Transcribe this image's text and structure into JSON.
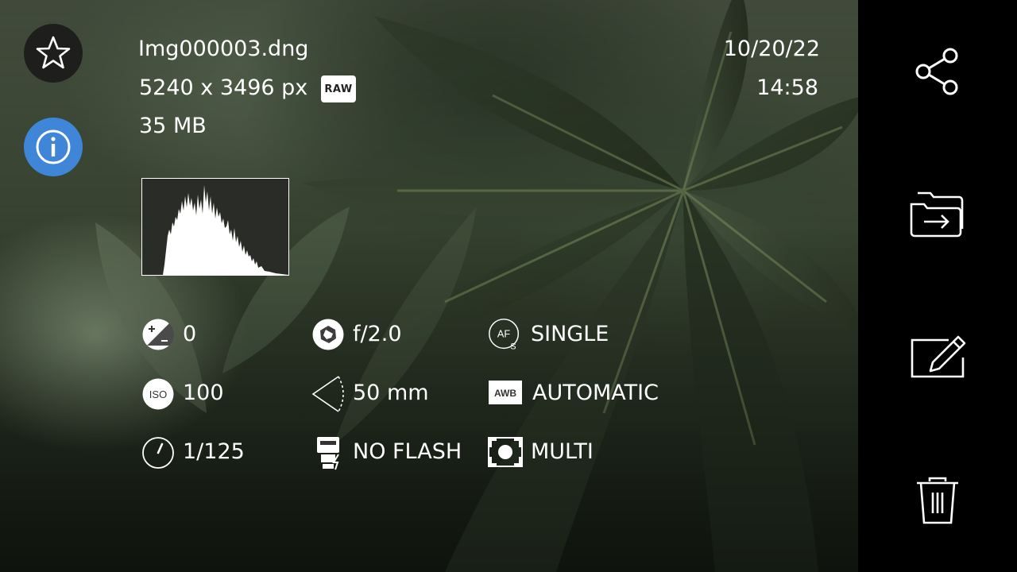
{
  "file": {
    "name": "Img000003.dng",
    "dimensions": "5240 x 3496 px",
    "format_badge": "RAW",
    "size": "35 MB",
    "date": "10/20/22",
    "time": "14:58"
  },
  "top_buttons": {
    "favorite_icon": "star-icon",
    "info_icon": "info-icon",
    "info_active_color": "#3f86d8"
  },
  "exif": {
    "exposure_comp": "0",
    "aperture": "f/2.0",
    "focus_mode": "SINGLE",
    "iso": "100",
    "focal_length": "50 mm",
    "white_balance": "AUTOMATIC",
    "shutter": "1/125",
    "flash": "NO FLASH",
    "metering": "MULTI",
    "iso_icon_label": "ISO",
    "awb_icon_label": "AWB",
    "af_icon_label": "AF",
    "af_icon_sub": "S"
  },
  "sidebar": {
    "share_icon": "share-icon",
    "move_icon": "move-to-folder-icon",
    "edit_icon": "edit-icon",
    "delete_icon": "trash-icon"
  }
}
